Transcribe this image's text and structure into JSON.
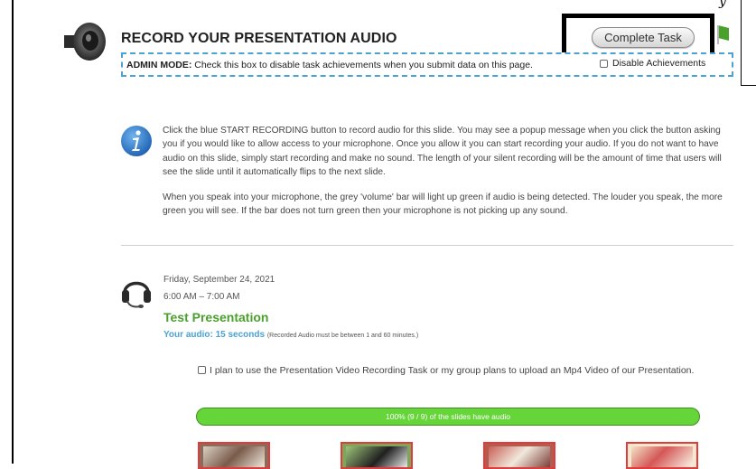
{
  "header": {
    "title": "RECORD YOUR PRESENTATION AUDIO",
    "complete_button": "Complete Task",
    "top_glyph": "y"
  },
  "admin": {
    "label": "ADMIN MODE:",
    "text": "Check this box to disable task achievements when you submit data on this page.",
    "checkbox_label": "Disable Achievements"
  },
  "info": {
    "paragraph1": "Click the blue START RECORDING button to record audio for this slide. You may see a popup message when you click the button asking you if you would like to allow access to your microphone. Once you allow it you can start recording your audio. If you do not want to have audio on this slide, simply start recording and make no sound. The length of your silent recording will be the amount of time that users will see the slide until it automatically flips to the next slide.",
    "paragraph2": "When you speak into your microphone, the grey 'volume' bar will light up green if audio is being detected. The louder you speak, the more green you will see. If the bar does not turn green then your microphone is not picking up any sound."
  },
  "presentation": {
    "date": "Friday, September 24, 2021",
    "time": "6:00 AM – 7:00 AM",
    "title": "Test Presentation",
    "audio_label": "Your audio: 15 seconds",
    "audio_note": "(Recorded Audio must be between 1 and 60 minutes.)",
    "plan_label": "I plan to use the Presentation Video Recording Task or my group plans to upload an Mp4 Video of our Presentation.",
    "progress_text": "100% (9 / 9) of the slides have audio",
    "progress_fraction": 1.0
  },
  "icons": {
    "speaker": "speaker-icon",
    "flag": "flag-icon",
    "info": "info-icon",
    "headset": "headset-icon"
  },
  "colors": {
    "accent_blue": "#4aa3d3",
    "title_green": "#4aa02c",
    "progress_green": "#66d53a",
    "thumb_border": "#e23b3b"
  }
}
